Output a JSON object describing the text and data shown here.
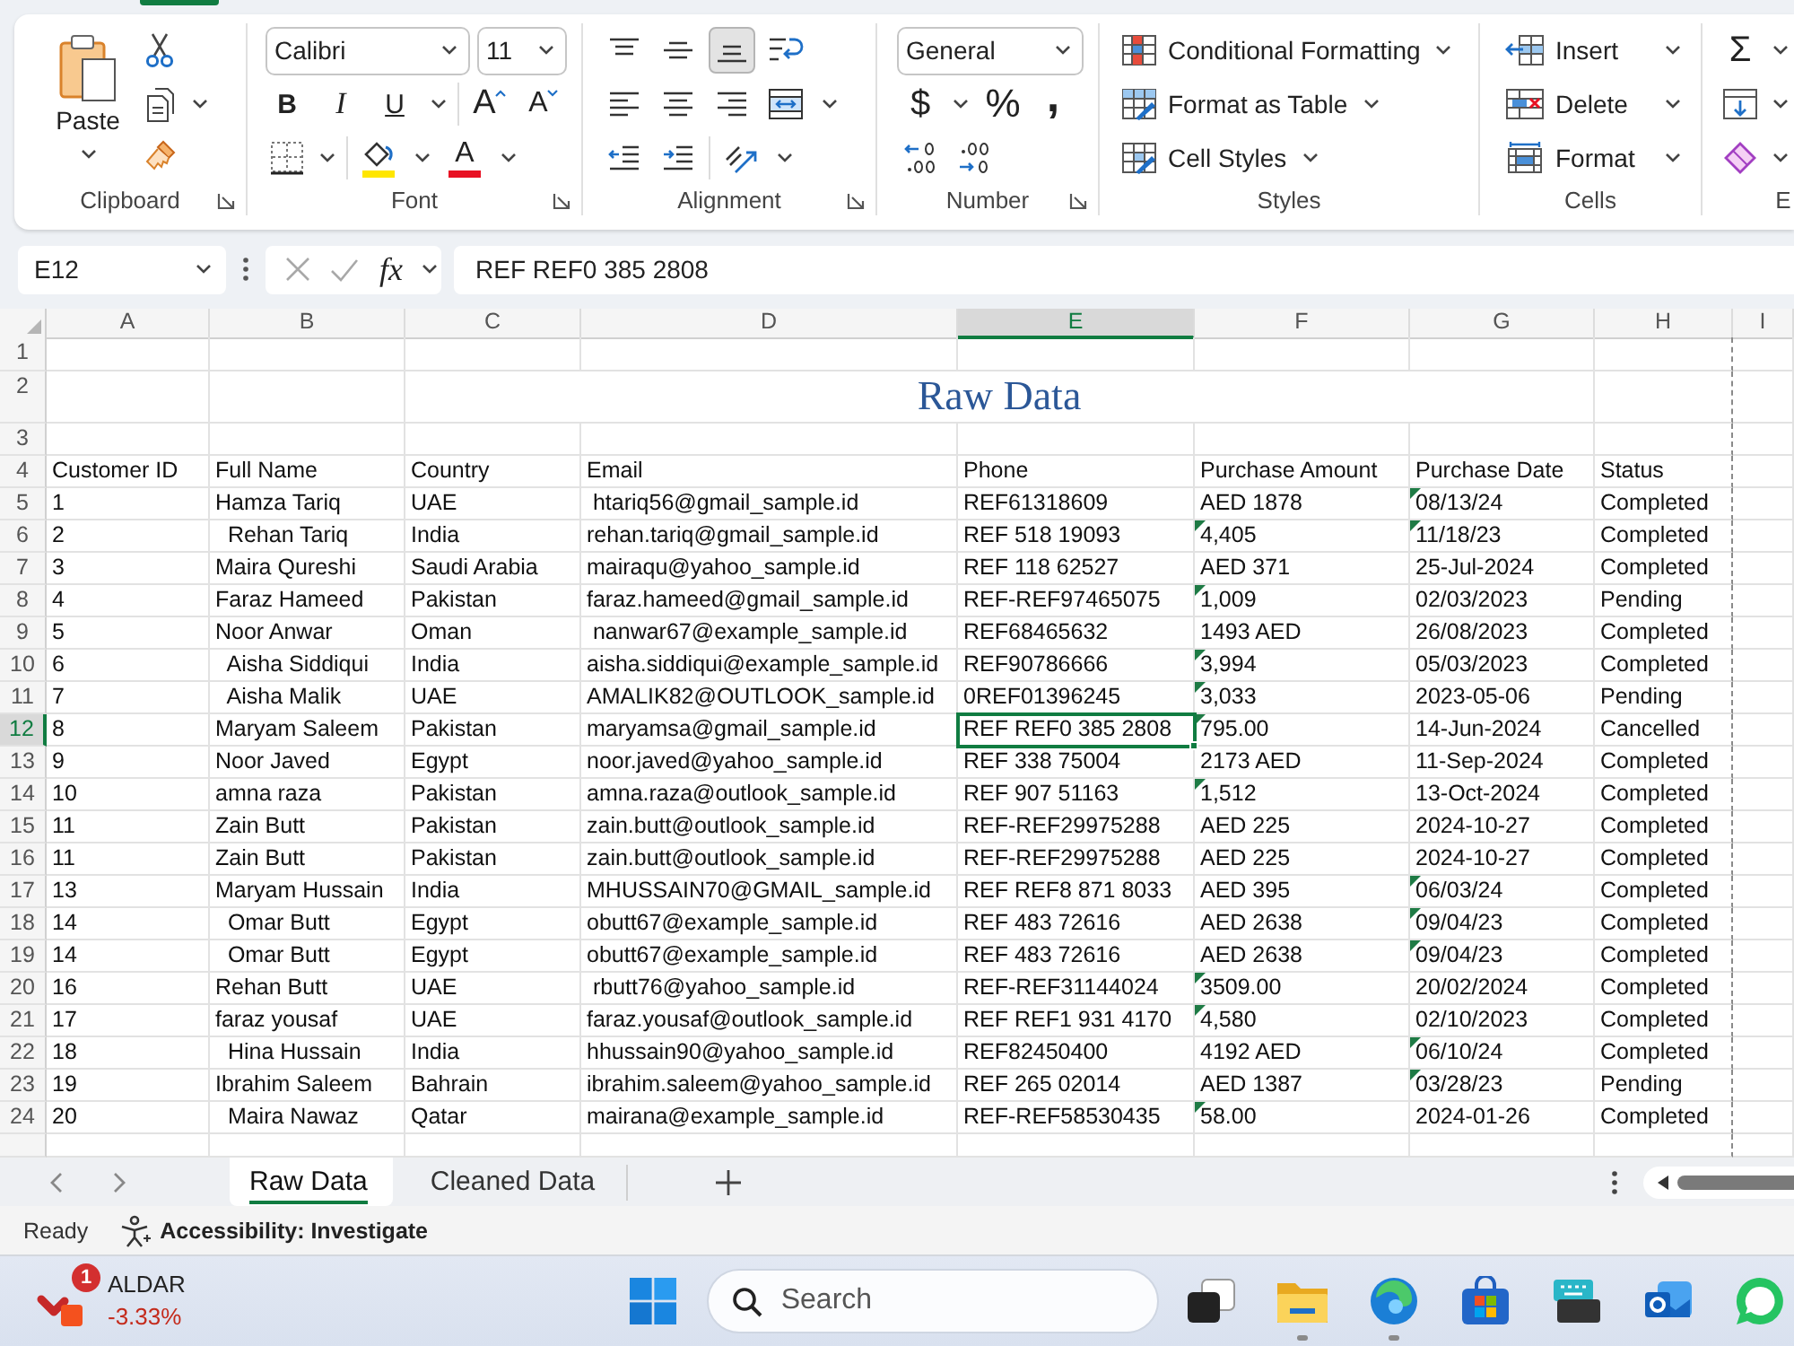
{
  "ribbon": {
    "clipboard": {
      "paste": "Paste",
      "label": "Clipboard"
    },
    "font": {
      "family": "Calibri",
      "size": "11",
      "bold": "B",
      "italic": "I",
      "underline": "U",
      "increase_size": "A",
      "decrease_size": "A",
      "font_color": "A",
      "label": "Font"
    },
    "alignment": {
      "vertical": [
        {
          "kind": "top",
          "selected": false
        },
        {
          "kind": "middle",
          "selected": false
        },
        {
          "kind": "bottom",
          "selected": true
        }
      ],
      "horizontal": [
        {
          "kind": "left",
          "selected": false
        },
        {
          "kind": "center",
          "selected": false
        },
        {
          "kind": "right",
          "selected": false
        }
      ],
      "label": "Alignment"
    },
    "number": {
      "format": "General",
      "currency": "$",
      "percent": "%",
      "comma": ",",
      "label": "Number"
    },
    "styles": {
      "items": [
        {
          "kind": "conditional",
          "label": "Conditional Formatting"
        },
        {
          "kind": "table",
          "label": "Format as Table"
        },
        {
          "kind": "cell",
          "label": "Cell Styles"
        }
      ],
      "label": "Styles"
    },
    "cells": {
      "items": [
        {
          "kind": "insert",
          "label": "Insert"
        },
        {
          "kind": "delete",
          "label": "Delete"
        },
        {
          "kind": "format",
          "label": "Format"
        }
      ],
      "label": "Cells"
    },
    "editing": {
      "sum": "Σ",
      "label": "E"
    }
  },
  "formula_bar": {
    "name_box": "E12",
    "function_label": "fx",
    "formula": "REF REF0 385 2808",
    "editing": false
  },
  "sheet": {
    "columns": [
      {
        "letter": "A",
        "selected": false
      },
      {
        "letter": "B",
        "selected": false
      },
      {
        "letter": "C",
        "selected": false
      },
      {
        "letter": "D",
        "selected": false
      },
      {
        "letter": "E",
        "selected": true
      },
      {
        "letter": "F",
        "selected": false
      },
      {
        "letter": "G",
        "selected": false
      },
      {
        "letter": "H",
        "selected": false
      },
      {
        "letter": "I",
        "selected": false
      }
    ],
    "row_headers": [
      {
        "label": "1",
        "selected": false
      },
      {
        "label": "2",
        "selected": false
      },
      {
        "label": "3",
        "selected": false
      },
      {
        "label": "4",
        "selected": false
      },
      {
        "label": "5",
        "selected": false
      },
      {
        "label": "6",
        "selected": false
      },
      {
        "label": "7",
        "selected": false
      },
      {
        "label": "8",
        "selected": false
      },
      {
        "label": "9",
        "selected": false
      },
      {
        "label": "10",
        "selected": false
      },
      {
        "label": "11",
        "selected": false
      },
      {
        "label": "12",
        "selected": true
      },
      {
        "label": "13",
        "selected": false
      },
      {
        "label": "14",
        "selected": false
      },
      {
        "label": "15",
        "selected": false
      },
      {
        "label": "16",
        "selected": false
      },
      {
        "label": "17",
        "selected": false
      },
      {
        "label": "18",
        "selected": false
      },
      {
        "label": "19",
        "selected": false
      },
      {
        "label": "20",
        "selected": false
      },
      {
        "label": "21",
        "selected": false
      },
      {
        "label": "22",
        "selected": false
      },
      {
        "label": "23",
        "selected": false
      },
      {
        "label": "24",
        "selected": false
      }
    ],
    "title": "Raw Data",
    "headers": [
      "Customer ID",
      "Full Name",
      "Country",
      "Email",
      "Phone",
      "Purchase Amount",
      "Purchase Date",
      "Status"
    ],
    "records": [
      {
        "customer_id": "1",
        "full_name": "Hamza Tariq",
        "country": "UAE",
        "email": " htariq56@gmail_sample.id",
        "phone": "REF61318609",
        "amount": "AED 1878",
        "amount_flagged": false,
        "date": "08/13/24",
        "date_flagged": true,
        "status": "Completed"
      },
      {
        "customer_id": "2",
        "full_name": "  Rehan Tariq",
        "country": "India",
        "email": "rehan.tariq@gmail_sample.id",
        "phone": "REF 518 19093",
        "amount": "4,405",
        "amount_flagged": true,
        "date": "11/18/23",
        "date_flagged": true,
        "status": "Completed"
      },
      {
        "customer_id": "3",
        "full_name": "Maira Qureshi",
        "country": "Saudi Arabia",
        "email": "mairaqu@yahoo_sample.id",
        "phone": "REF 118 62527",
        "amount": "AED 371",
        "amount_flagged": false,
        "date": "25-Jul-2024",
        "date_flagged": false,
        "status": "Completed"
      },
      {
        "customer_id": "4",
        "full_name": "Faraz Hameed",
        "country": "Pakistan",
        "email": "faraz.hameed@gmail_sample.id",
        "phone": "REF-REF97465075",
        "amount": "1,009",
        "amount_flagged": true,
        "date": "02/03/2023",
        "date_flagged": false,
        "status": "Pending"
      },
      {
        "customer_id": "5",
        "full_name": "Noor Anwar",
        "country": "Oman",
        "email": " nanwar67@example_sample.id",
        "phone": "REF68465632",
        "amount": "1493 AED",
        "amount_flagged": false,
        "date": "26/08/2023",
        "date_flagged": false,
        "status": "Completed"
      },
      {
        "customer_id": "6",
        "full_name": "  Aisha Siddiqui",
        "country": "India",
        "email": "aisha.siddiqui@example_sample.id",
        "phone": "REF90786666",
        "amount": "3,994",
        "amount_flagged": true,
        "date": "05/03/2023",
        "date_flagged": false,
        "status": "Completed"
      },
      {
        "customer_id": "7",
        "full_name": "  Aisha Malik",
        "country": "UAE",
        "email": "AMALIK82@OUTLOOK_sample.id",
        "phone": "0REF01396245",
        "amount": "3,033",
        "amount_flagged": true,
        "date": "2023-05-06",
        "date_flagged": false,
        "status": "Pending"
      },
      {
        "customer_id": "8",
        "full_name": "Maryam Saleem",
        "country": "Pakistan",
        "email": "maryamsa@gmail_sample.id",
        "phone": "REF REF0 385 2808",
        "amount": "795.00",
        "amount_flagged": true,
        "date": "14-Jun-2024",
        "date_flagged": false,
        "status": "Cancelled"
      },
      {
        "customer_id": "9",
        "full_name": "Noor Javed",
        "country": "Egypt",
        "email": "noor.javed@yahoo_sample.id",
        "phone": "REF 338 75004",
        "amount": "2173 AED",
        "amount_flagged": false,
        "date": "11-Sep-2024",
        "date_flagged": false,
        "status": "Completed"
      },
      {
        "customer_id": "10",
        "full_name": "amna raza",
        "country": "Pakistan",
        "email": "amna.raza@outlook_sample.id",
        "phone": "REF 907 51163",
        "amount": "1,512",
        "amount_flagged": true,
        "date": "13-Oct-2024",
        "date_flagged": false,
        "status": "Completed"
      },
      {
        "customer_id": "11",
        "full_name": "Zain Butt",
        "country": "Pakistan",
        "email": "zain.butt@outlook_sample.id",
        "phone": "REF-REF29975288",
        "amount": "AED 225",
        "amount_flagged": false,
        "date": "2024-10-27",
        "date_flagged": false,
        "status": "Completed"
      },
      {
        "customer_id": "11",
        "full_name": "Zain Butt",
        "country": "Pakistan",
        "email": "zain.butt@outlook_sample.id",
        "phone": "REF-REF29975288",
        "amount": "AED 225",
        "amount_flagged": false,
        "date": "2024-10-27",
        "date_flagged": false,
        "status": "Completed"
      },
      {
        "customer_id": "13",
        "full_name": "Maryam Hussain",
        "country": "India",
        "email": "MHUSSAIN70@GMAIL_sample.id",
        "phone": "REF REF8 871 8033",
        "amount": "AED 395",
        "amount_flagged": false,
        "date": "06/03/24",
        "date_flagged": true,
        "status": "Completed"
      },
      {
        "customer_id": "14",
        "full_name": "  Omar Butt",
        "country": "Egypt",
        "email": "obutt67@example_sample.id",
        "phone": "REF 483 72616",
        "amount": "AED 2638",
        "amount_flagged": false,
        "date": "09/04/23",
        "date_flagged": true,
        "status": "Completed"
      },
      {
        "customer_id": "14",
        "full_name": "  Omar Butt",
        "country": "Egypt",
        "email": "obutt67@example_sample.id",
        "phone": "REF 483 72616",
        "amount": "AED 2638",
        "amount_flagged": false,
        "date": "09/04/23",
        "date_flagged": true,
        "status": "Completed"
      },
      {
        "customer_id": "16",
        "full_name": "Rehan Butt",
        "country": "UAE",
        "email": " rbutt76@yahoo_sample.id",
        "phone": "REF-REF31144024",
        "amount": "3509.00",
        "amount_flagged": true,
        "date": "20/02/2024",
        "date_flagged": false,
        "status": "Completed"
      },
      {
        "customer_id": "17",
        "full_name": "faraz yousaf",
        "country": "UAE",
        "email": "faraz.yousaf@outlook_sample.id",
        "phone": "REF REF1 931 4170",
        "amount": "4,580",
        "amount_flagged": true,
        "date": "02/10/2023",
        "date_flagged": false,
        "status": "Completed"
      },
      {
        "customer_id": "18",
        "full_name": "  Hina Hussain",
        "country": "India",
        "email": "hhussain90@yahoo_sample.id",
        "phone": "REF82450400",
        "amount": "4192 AED",
        "amount_flagged": false,
        "date": "06/10/24",
        "date_flagged": true,
        "status": "Completed"
      },
      {
        "customer_id": "19",
        "full_name": "Ibrahim Saleem",
        "country": "Bahrain",
        "email": "ibrahim.saleem@yahoo_sample.id",
        "phone": "REF 265 02014",
        "amount": "AED 1387",
        "amount_flagged": false,
        "date": "03/28/23",
        "date_flagged": true,
        "status": "Pending"
      },
      {
        "customer_id": "20",
        "full_name": "  Maira Nawaz",
        "country": "Qatar",
        "email": "mairana@example_sample.id",
        "phone": "REF-REF58530435",
        "amount": "58.00",
        "amount_flagged": true,
        "date": "2024-01-26",
        "date_flagged": false,
        "status": "Completed"
      }
    ]
  },
  "sheet_tabs": [
    {
      "label": "Raw Data",
      "selected": true
    },
    {
      "label": "Cleaned Data",
      "selected": false
    }
  ],
  "status_bar": {
    "mode": "Ready",
    "accessibility": "Accessibility: Investigate"
  },
  "taskbar": {
    "widget": {
      "badge": "1",
      "name": "ALDAR",
      "change": "-3.33%"
    },
    "search": {
      "placeholder": "Search"
    },
    "apps": [
      {
        "kind": "task_view",
        "running": false
      },
      {
        "kind": "folder",
        "running": true
      },
      {
        "kind": "browser",
        "running": true
      },
      {
        "kind": "store",
        "running": false
      },
      {
        "kind": "keyboard",
        "running": false
      },
      {
        "kind": "mail",
        "running": false
      },
      {
        "kind": "chat",
        "running": false
      }
    ]
  }
}
